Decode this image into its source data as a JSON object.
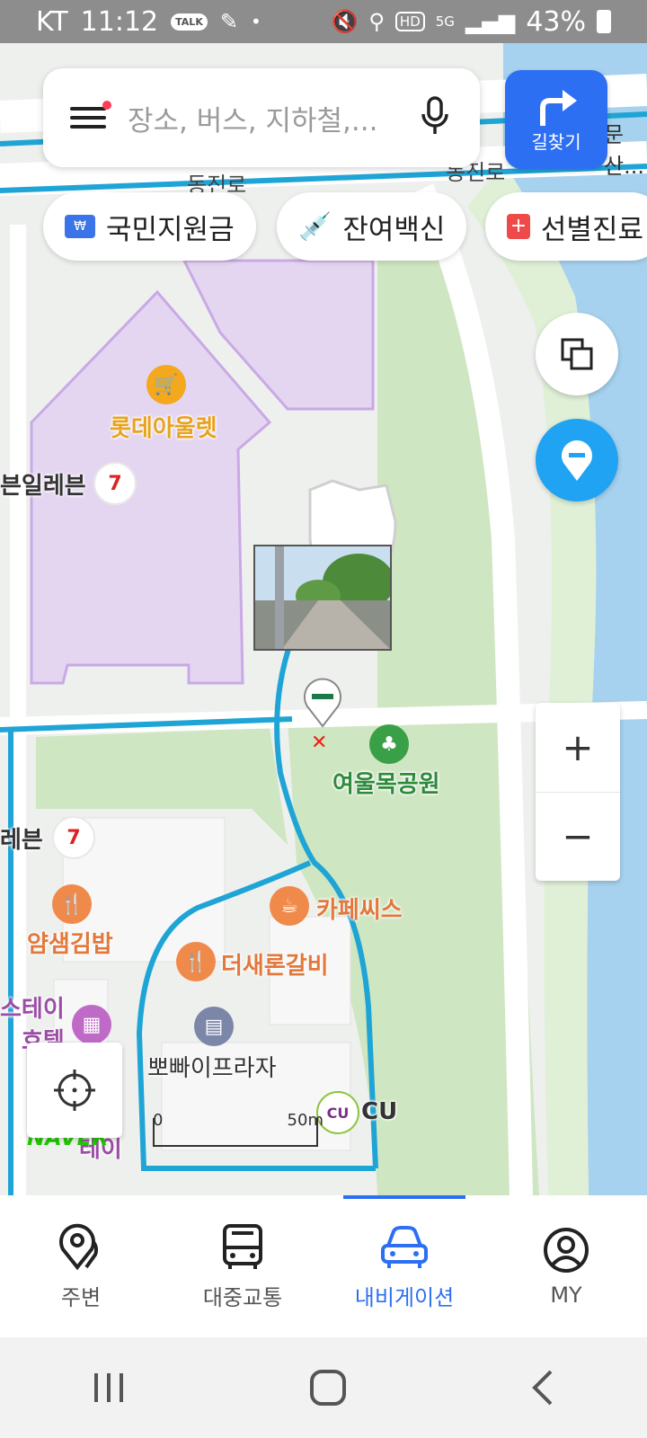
{
  "status_bar": {
    "carrier": "KT",
    "time": "11:12",
    "talk_badge": "TALK",
    "hd": "HD",
    "network": "5G",
    "battery": "43%"
  },
  "search": {
    "placeholder": "장소, 버스, 지하철,..."
  },
  "route_button": {
    "label": "길찾기"
  },
  "chips": [
    {
      "label": "국민지원금",
      "icon": "won-card-icon"
    },
    {
      "label": "잔여백신",
      "icon": "syringe-icon"
    },
    {
      "label": "선별진료",
      "icon": "hospital-cross-icon"
    }
  ],
  "map": {
    "roads": [
      "동진로",
      "동진로"
    ],
    "edge_labels": [
      "문산..."
    ],
    "pois": [
      {
        "name": "롯데아울렛",
        "color": "#e8a21c"
      },
      {
        "name": "븐일레븐",
        "color": "#333333"
      },
      {
        "name": "여울목공원",
        "color": "#2f8a3c"
      },
      {
        "name": "레븐",
        "color": "#333333"
      },
      {
        "name": "얌샘김밥",
        "color": "#e2783c"
      },
      {
        "name": "카페씨스",
        "color": "#e2783c"
      },
      {
        "name": "더새론갈비",
        "color": "#e2783c"
      },
      {
        "name": "스테이",
        "color": "#9b4da6"
      },
      {
        "name": "호텔",
        "color": "#9b4da6"
      },
      {
        "name": "뽀빠이프라자",
        "color": "#333333"
      },
      {
        "name": "CU",
        "color": "#333333"
      },
      {
        "name": "테이",
        "color": "#9b4da6"
      }
    ],
    "scale": {
      "start": "0",
      "end": "50m"
    },
    "brand": "NAVER"
  },
  "zoom": {
    "in": "+",
    "out": "−"
  },
  "bottom_nav": [
    {
      "label": "주변",
      "icon": "place-pin-icon",
      "active": false
    },
    {
      "label": "대중교통",
      "icon": "bus-icon",
      "active": false
    },
    {
      "label": "내비게이션",
      "icon": "car-icon",
      "active": true
    },
    {
      "label": "MY",
      "icon": "user-icon",
      "active": false
    }
  ],
  "colors": {
    "accent": "#2d6ff2",
    "route": "#1fa4d6",
    "park": "#cfe6c2",
    "river": "#a6d2ef",
    "mall": "#e4d6f1"
  }
}
